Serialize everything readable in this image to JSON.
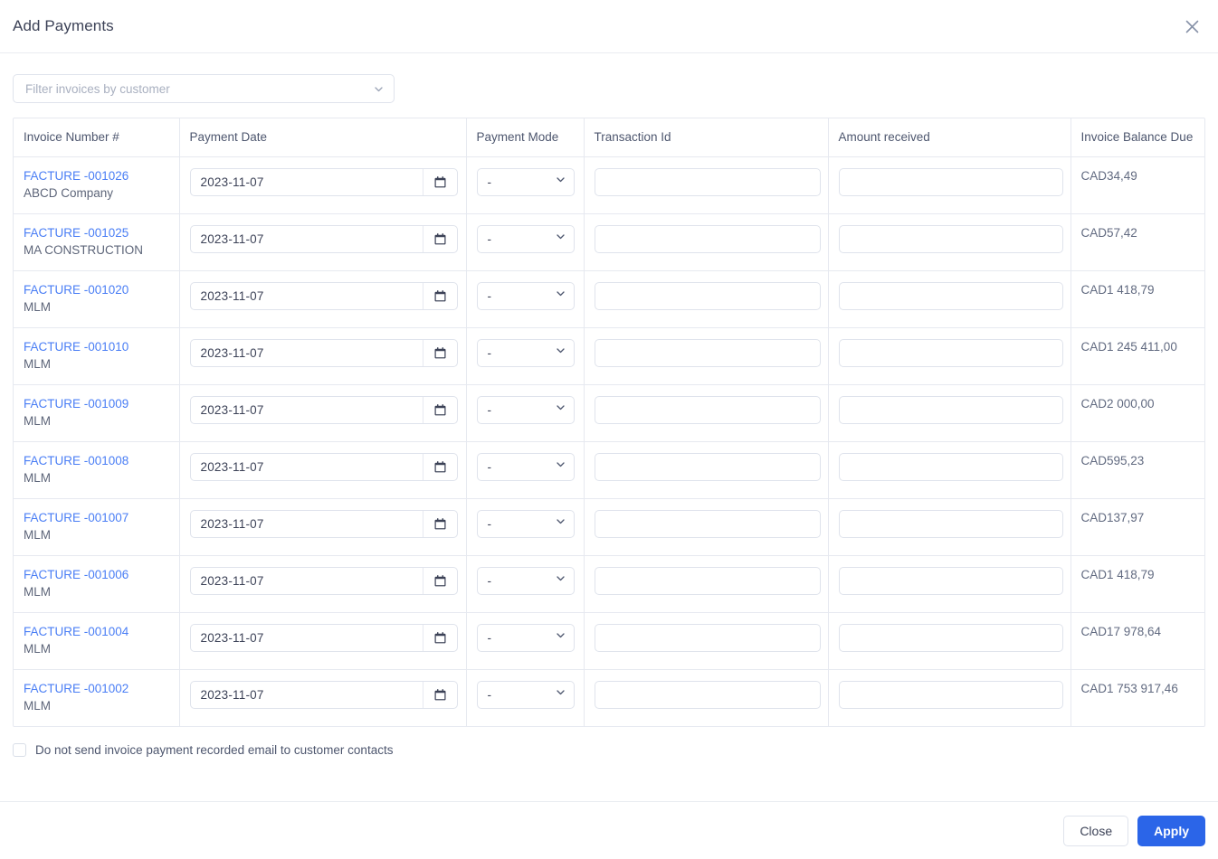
{
  "dialog": {
    "title": "Add Payments",
    "close_icon": "close-icon"
  },
  "filter": {
    "placeholder": "Filter invoices by customer",
    "chevron_icon": "chevron-down-icon"
  },
  "table": {
    "columns": [
      "Invoice Number #",
      "Payment Date",
      "Payment Mode",
      "Transaction Id",
      "Amount received",
      "Invoice Balance Due"
    ],
    "rows": [
      {
        "invoice": "FACTURE -001026",
        "customer": "ABCD Company",
        "payment_date": "2023-11-07",
        "payment_mode": "-",
        "transaction_id": "",
        "amount_received": "",
        "balance_due": "CAD34,49"
      },
      {
        "invoice": "FACTURE -001025",
        "customer": "MA CONSTRUCTION",
        "payment_date": "2023-11-07",
        "payment_mode": "-",
        "transaction_id": "",
        "amount_received": "",
        "balance_due": "CAD57,42"
      },
      {
        "invoice": "FACTURE -001020",
        "customer": "MLM",
        "payment_date": "2023-11-07",
        "payment_mode": "-",
        "transaction_id": "",
        "amount_received": "",
        "balance_due": "CAD1 418,79"
      },
      {
        "invoice": "FACTURE -001010",
        "customer": "MLM",
        "payment_date": "2023-11-07",
        "payment_mode": "-",
        "transaction_id": "",
        "amount_received": "",
        "balance_due": "CAD1 245 411,00"
      },
      {
        "invoice": "FACTURE -001009",
        "customer": "MLM",
        "payment_date": "2023-11-07",
        "payment_mode": "-",
        "transaction_id": "",
        "amount_received": "",
        "balance_due": "CAD2 000,00"
      },
      {
        "invoice": "FACTURE -001008",
        "customer": "MLM",
        "payment_date": "2023-11-07",
        "payment_mode": "-",
        "transaction_id": "",
        "amount_received": "",
        "balance_due": "CAD595,23"
      },
      {
        "invoice": "FACTURE -001007",
        "customer": "MLM",
        "payment_date": "2023-11-07",
        "payment_mode": "-",
        "transaction_id": "",
        "amount_received": "",
        "balance_due": "CAD137,97"
      },
      {
        "invoice": "FACTURE -001006",
        "customer": "MLM",
        "payment_date": "2023-11-07",
        "payment_mode": "-",
        "transaction_id": "",
        "amount_received": "",
        "balance_due": "CAD1 418,79"
      },
      {
        "invoice": "FACTURE -001004",
        "customer": "MLM",
        "payment_date": "2023-11-07",
        "payment_mode": "-",
        "transaction_id": "",
        "amount_received": "",
        "balance_due": "CAD17 978,64"
      },
      {
        "invoice": "FACTURE -001002",
        "customer": "MLM",
        "payment_date": "2023-11-07",
        "payment_mode": "-",
        "transaction_id": "",
        "amount_received": "",
        "balance_due": "CAD1 753 917,46"
      }
    ]
  },
  "options": {
    "no_email_label": "Do not send invoice payment recorded email to customer contacts",
    "no_email_checked": false
  },
  "footer": {
    "close_label": "Close",
    "apply_label": "Apply"
  },
  "colors": {
    "link": "#4a7ef5",
    "primary_button": "#2b65e8",
    "border": "#e6e9f0",
    "text": "#3c4257",
    "placeholder": "#a9b0c0"
  }
}
